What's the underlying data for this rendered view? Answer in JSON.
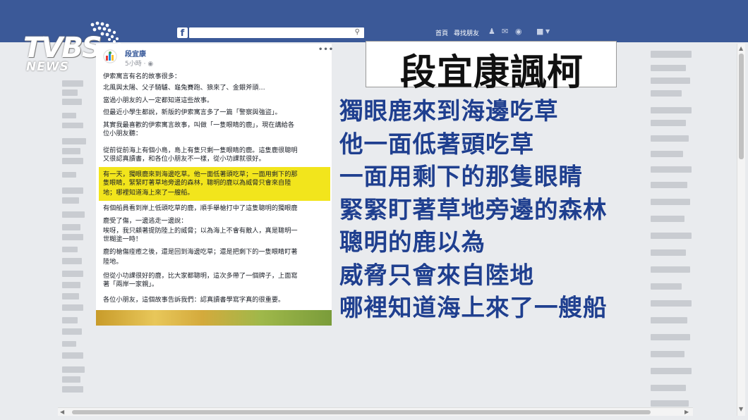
{
  "topbar": {
    "logo": "f",
    "nav_home": "首頁",
    "nav_find_friends": "尋找朋友",
    "icons": [
      "friends-icon",
      "messages-icon",
      "globe-icon",
      "lock-icon"
    ]
  },
  "brand": {
    "name": "TVBS",
    "sub": "NEWS"
  },
  "post": {
    "author": "段宜康",
    "time": "5小時 · ",
    "menu": "•••",
    "lines": [
      "伊索寓言有名的故事很多：",
      "北風與太陽、父子騎驢、龜兔賽跑、狼來了、金銀斧頭…",
      "當過小朋友的人一定都知道這些故事。",
      "但最近小學生都說，新版的伊索寓言多了一篇「警察與強盜」。",
      "其實我最喜歡的伊索寓言故事，叫做「一隻眼睛的鹿」，現在講給各",
      "位小朋友聽：",
      "從前從前海上有個小島，島上有隻只剩一隻眼睛的鹿。這隻鹿很聰明",
      "又很認真讀書，和各位小朋友不一樣，從小功課就很好。",
      "有一天，獨眼鹿來到海邊吃草。他一面低著頭吃草；一面用剩下的那",
      "隻眼睛，緊緊盯著草地旁邊的森林，聰明的鹿以為威脅只會來自陸",
      "地；哪裡知道海上來了一艘船。",
      "有個船員看到岸上低頭吃草的鹿，順手舉槍打中了這隻聰明的獨眼鹿",
      "鹿受了傷，一邊逃走一邊說：",
      "唉呀，我只顧著提防陸上的威脅；以為海上不會有敵人，真是聰明一",
      "世糊塗一時！",
      "鹿的槍傷痊癒之後，還是回到海邊吃草；還是把剩下的一隻眼睛盯著",
      "陸地。",
      "但從小功課很好的鹿，比大家都聰明，這次多帶了一個牌子，上面寫",
      "著「兩岸一家親」。",
      "各位小朋友，這個故事告訴我們：認真讀書學寫字真的很重要。"
    ]
  },
  "headline": "段宜康諷柯",
  "captions": [
    "獨眼鹿來到海邊吃草",
    "他一面低著頭吃草",
    "一面用剩下的那隻眼睛",
    "緊緊盯著草地旁邊的森林",
    "聰明的鹿以為",
    "威脅只會來自陸地",
    "哪裡知道海上來了一艘船"
  ],
  "colors": {
    "facebook_blue": "#3b5998",
    "caption_blue": "#1f3f8f",
    "highlight_yellow": "#f2e51c"
  }
}
